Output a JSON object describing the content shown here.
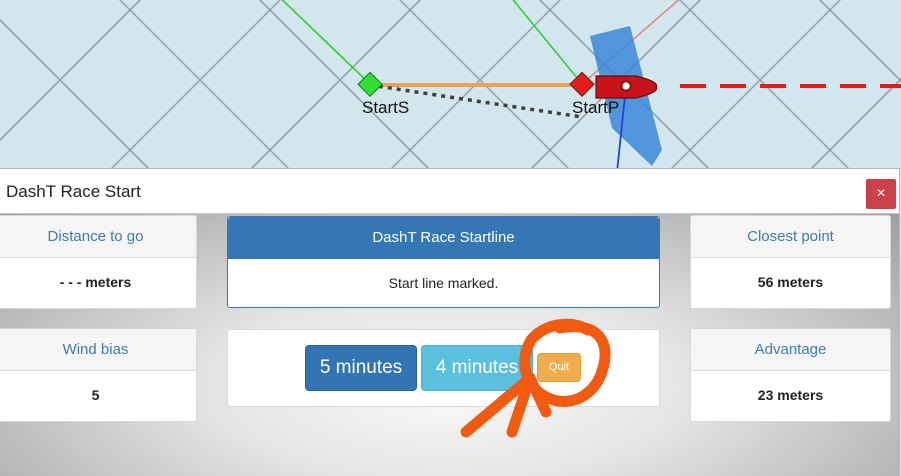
{
  "map": {
    "marks": [
      {
        "label": "StartS",
        "color": "#1ed81e"
      },
      {
        "label": "StartP",
        "color": "#e21b1b"
      }
    ],
    "colors": {
      "water": "#d2e6ee",
      "startline": "#eaa15a",
      "layline": "#7c7c7c",
      "boat": "#c9131b",
      "wind_sector": "#3b86d6"
    }
  },
  "dialog": {
    "title": "DashT Race Start",
    "close_label": "×",
    "distance": {
      "label": "Distance to go",
      "value": "- - - meters"
    },
    "startline": {
      "label": "DashT Race Startline",
      "status": "Start line marked."
    },
    "closest": {
      "label": "Closest point",
      "value": "56 meters"
    },
    "wind_bias": {
      "label": "Wind bias",
      "value": "5"
    },
    "timers": {
      "five_label": "5 minutes",
      "four_label": "4 minutes",
      "quit_label": "Quit"
    },
    "advantage": {
      "label": "Advantage",
      "value": "23 meters"
    }
  },
  "annotation": {
    "color": "#f25a10",
    "icon": "hand-drawn-circle-arrow"
  }
}
